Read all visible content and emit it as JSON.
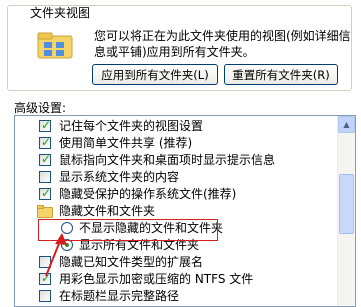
{
  "folder_views": {
    "title": "文件夹视图",
    "description": "您可以将正在为此文件夹使用的视图(例如详细信息或平铺)应用到所有文件夹。",
    "apply_button": "应用到所有文件夹(L)",
    "reset_button": "重置所有文件夹(R)"
  },
  "advanced": {
    "label": "高级设置:",
    "items": [
      {
        "type": "checkbox",
        "checked": true,
        "label": "记住每个文件夹的视图设置"
      },
      {
        "type": "checkbox",
        "checked": true,
        "label": "使用简单文件共享 (推荐)"
      },
      {
        "type": "checkbox",
        "checked": true,
        "label": "鼠标指向文件夹和桌面项时显示提示信息"
      },
      {
        "type": "checkbox",
        "checked": false,
        "label": "显示系统文件夹的内容"
      },
      {
        "type": "checkbox",
        "checked": true,
        "label": "隐藏受保护的操作系统文件(推荐)"
      },
      {
        "type": "folder",
        "label": "隐藏文件和文件夹"
      },
      {
        "type": "radio",
        "selected": false,
        "label": "不显示隐藏的文件和文件夹"
      },
      {
        "type": "radio",
        "selected": true,
        "label": "显示所有文件和文件夹"
      },
      {
        "type": "checkbox",
        "checked": false,
        "label": "隐藏已知文件类型的扩展名"
      },
      {
        "type": "checkbox",
        "checked": true,
        "label": "用彩色显示加密或压缩的 NTFS 文件"
      },
      {
        "type": "checkbox",
        "checked": false,
        "label": "在标题栏显示完整路径"
      }
    ]
  },
  "colors": {
    "check": "#21a121",
    "highlight": "#d42020",
    "border": "#7f9db9"
  }
}
